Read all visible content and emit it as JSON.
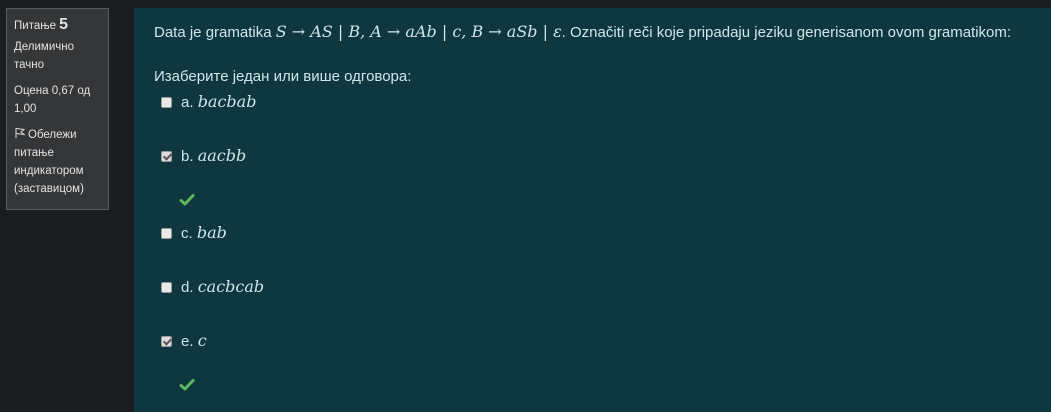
{
  "info": {
    "question_label": "Питање",
    "question_number": "5",
    "state": "Делимично тачно",
    "grade": "Оцена 0,67 од 1,00",
    "flag_label": "Обележи питање индикатором (заставицом)"
  },
  "question": {
    "text_prefix": "Data je gramatika ",
    "grammar": "S → AS | B, A → aAb | c, B → aSb | ε",
    "text_suffix": ". Označiti reči koje pripadaju jeziku generisanom ovom gramatikom:",
    "prompt": "Изаберите један или више одговора:"
  },
  "options": [
    {
      "letter": "a.",
      "word": "bacbab",
      "checked": false,
      "correct_mark": false
    },
    {
      "letter": "b.",
      "word": "aacbb",
      "checked": true,
      "correct_mark": true
    },
    {
      "letter": "c.",
      "word": "bab",
      "checked": false,
      "correct_mark": false
    },
    {
      "letter": "d.",
      "word": "cacbcab",
      "checked": false,
      "correct_mark": false
    },
    {
      "letter": "e.",
      "word": "c",
      "checked": true,
      "correct_mark": true
    }
  ],
  "colors": {
    "content_bg": "#0e373f",
    "info_bg": "#343638",
    "correct_tick": "#5cb85c"
  }
}
